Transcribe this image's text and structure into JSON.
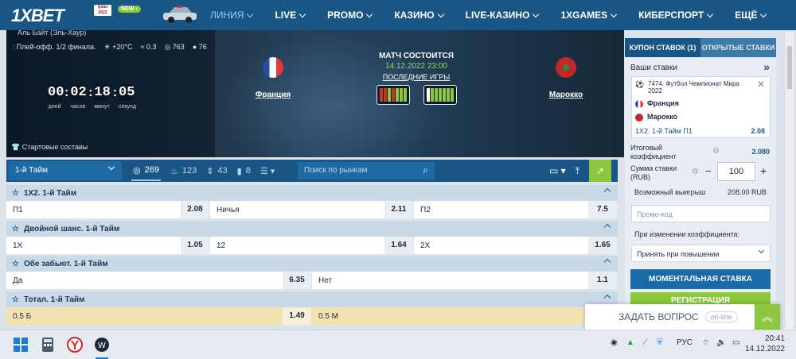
{
  "brand": {
    "logo": "1XBET",
    "qatar_badge": "Qatar 2022",
    "new_badge": "NEW"
  },
  "nav": {
    "items": [
      {
        "label": "ЛИНИЯ",
        "active": true,
        "dropdown": true
      },
      {
        "label": "LIVE",
        "dropdown": true
      },
      {
        "label": "PROMO",
        "dropdown": true
      },
      {
        "label": "КАЗИНО",
        "dropdown": true
      },
      {
        "label": "LIVE-КАЗИНО",
        "dropdown": true
      },
      {
        "label": "1XGAMES",
        "dropdown": true
      },
      {
        "label": "КИБЕРСПОРТ",
        "dropdown": true
      },
      {
        "label": "ЕЩЁ",
        "dropdown": true
      }
    ]
  },
  "match": {
    "venue": "Аль Байт (Эль-Хаур)",
    "meta": {
      "stage": "Плей-офф. 1/2 финала.",
      "temp": "+20°C",
      "wind": "0.3",
      "pressure": "763",
      "humidity": "76"
    },
    "countdown": {
      "days": "00",
      "hours": "02",
      "minutes": "18",
      "seconds": "05",
      "labels": {
        "days": "дней",
        "hours": "часов",
        "minutes": "минут",
        "seconds": "секунд"
      }
    },
    "lineups": "Стартовые составы",
    "status": "МАТЧ СОСТОИТСЯ",
    "datetime": "14.12.2022 23:00",
    "last_games": "ПОСЛЕДНИЕ ИГРЫ",
    "team1": {
      "name": "Франция",
      "flag": "france-flag-icon"
    },
    "team2": {
      "name": "Марокко",
      "flag": "morocco-flag-icon"
    },
    "form1": [
      "#c0392b",
      "#c0392b",
      "#8cc73f",
      "#c0392b",
      "#8cc73f",
      "#8cc73f",
      "#8cc73f"
    ],
    "form2": [
      "#ffffff",
      "#8cc73f",
      "#8cc73f",
      "#8cc73f",
      "#8cc73f",
      "#8cc73f",
      "#8cc73f"
    ]
  },
  "toolbar": {
    "period": "1-й Тайм",
    "count_all": "269",
    "count_hot": "123",
    "count_sort": "43",
    "count_stats": "8",
    "search_placeholder": "Поиск по рынкам"
  },
  "markets": [
    {
      "title": "1X2. 1-й Тайм",
      "rows": [
        [
          {
            "label": "П1",
            "odd": "2.08"
          },
          {
            "label": "Ничья",
            "odd": "2.11"
          },
          {
            "label": "П2",
            "odd": "7.5"
          }
        ]
      ]
    },
    {
      "title": "Двойной шанс. 1-й Тайм",
      "rows": [
        [
          {
            "label": "1X",
            "odd": "1.05"
          },
          {
            "label": "12",
            "odd": "1.64"
          },
          {
            "label": "2X",
            "odd": "1.65"
          }
        ]
      ]
    },
    {
      "title": "Обе забьют. 1-й Тайм",
      "rows": [
        [
          {
            "label": "Да",
            "odd": "6.35"
          },
          {
            "label": "Нет",
            "odd": "1.1"
          }
        ]
      ]
    },
    {
      "title": "Тотал. 1-й Тайм",
      "rows": [
        [
          {
            "label": "0.5 Б",
            "odd": "1.49"
          },
          {
            "label": "0.5 М",
            "odd": ""
          }
        ]
      ]
    }
  ],
  "coupon": {
    "tab_active": "КУПОН СТАВОК (1)",
    "tab_other": "ОТКРЫТЫЕ СТАВКИ",
    "your_bets": "Ваши ставки",
    "bet": {
      "event": "7474. Футбол Чемпионат Мира 2022",
      "team1": "Франция",
      "team2": "Марокко",
      "market": "1X2. 1-й Тайм П1",
      "odd": "2.08"
    },
    "total_coef_label": "Итоговый коэффициент",
    "total_coef": "2.080",
    "stake_label": "Сумма ставки (RUB)",
    "stake": "100",
    "win_label": "Возможный выигрыш",
    "win": "208.00 RUB",
    "promo_placeholder": "Промо-код",
    "on_change_label": "При изменении коэффициента:",
    "accept_option": "Принять при повышении",
    "quick_bet": "МОМЕНТАЛЬНАЯ СТАВКА",
    "register": "РЕГИСТРАЦИЯ"
  },
  "chat": {
    "label": "ЗАДАТЬ ВОПРОС",
    "status": "on-line"
  },
  "taskbar": {
    "lang": "РУС",
    "time": "20:41",
    "date": "14.12.2022"
  },
  "colors": {
    "nav": "#1a5685",
    "accent_green": "#8cc73f",
    "highlight": "#f3e3b3"
  }
}
